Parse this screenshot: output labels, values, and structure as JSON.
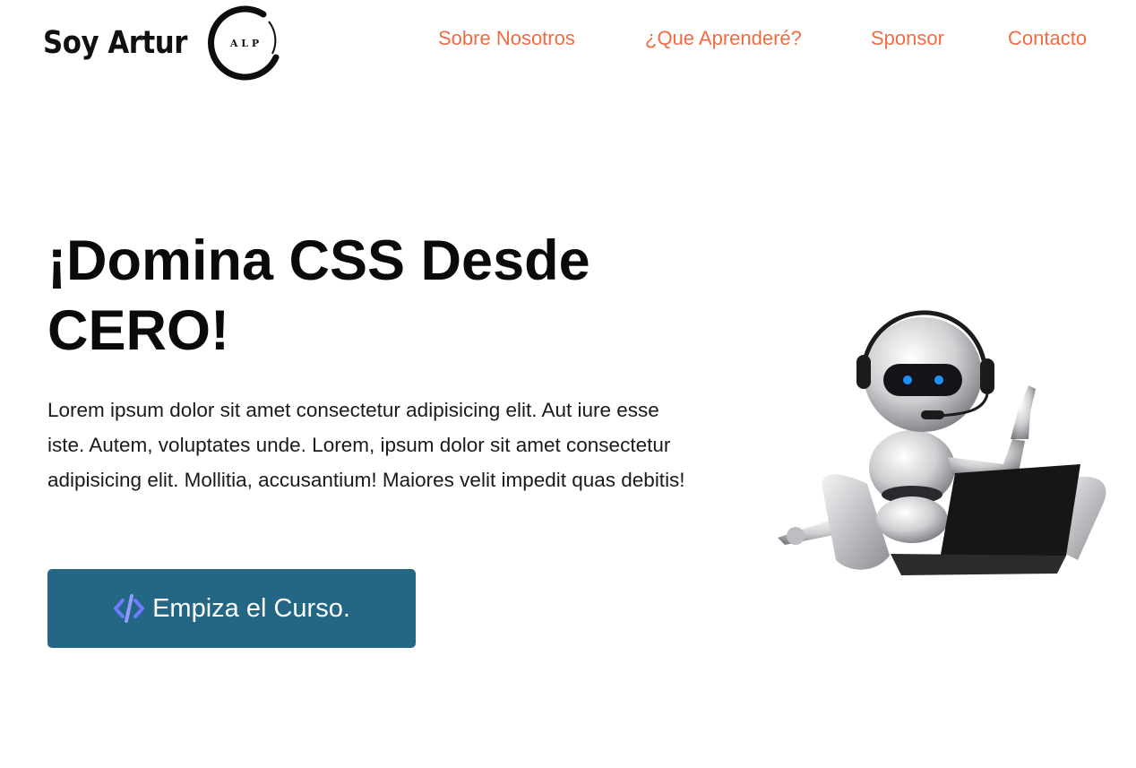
{
  "header": {
    "brand_name": "Soy Artur",
    "logo_text": "A L P",
    "nav": [
      {
        "label": "Sobre Nosotros"
      },
      {
        "label": "¿Que Aprenderé?"
      },
      {
        "label": "Sponsor"
      },
      {
        "label": "Contacto"
      }
    ]
  },
  "hero": {
    "title_line1": "¡Domina CSS Desde",
    "title_line2": "CERO!",
    "paragraph": "Lorem ipsum dolor sit amet consectetur adipisicing elit. Aut iure esse iste. Autem, voluptates unde. Lorem, ipsum dolor sit amet consectetur adipisicing elit. Mollitia, accusantium! Maiores velit impedit quas debitis!",
    "cta_label": "Empiza el Curso.",
    "cta_icon": "code-icon"
  },
  "illustration": {
    "name": "robot-with-laptop-illustration"
  },
  "colors": {
    "nav_link": "#f26b43",
    "cta_background": "#236785",
    "cta_icon": "#6b7cff",
    "text": "#0a0a0a"
  }
}
